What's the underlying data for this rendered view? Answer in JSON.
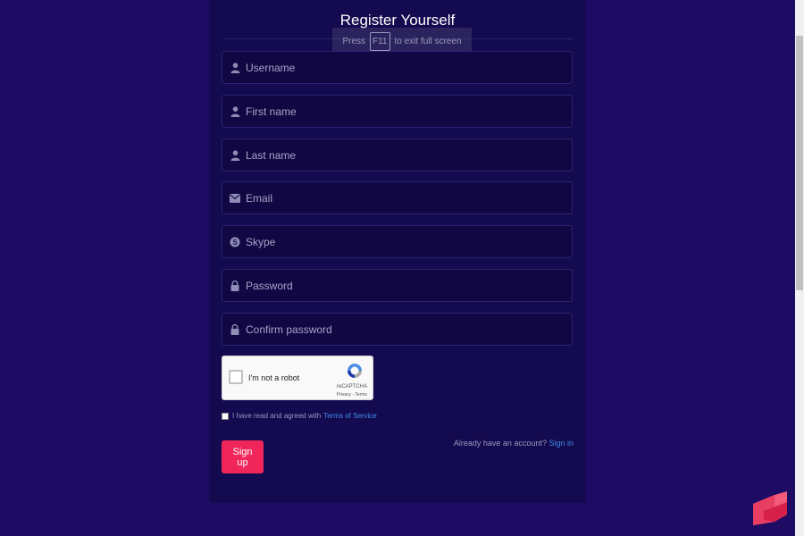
{
  "header": {
    "title": "Register Yourself"
  },
  "fullscreen_banner": {
    "prefix": "Press",
    "key": "F11",
    "suffix": "to exit full screen"
  },
  "form": {
    "username": {
      "placeholder": "Username",
      "icon": "user-icon"
    },
    "first_name": {
      "placeholder": "First name",
      "icon": "user-icon"
    },
    "last_name": {
      "placeholder": "Last name",
      "icon": "user-icon"
    },
    "email": {
      "placeholder": "Email",
      "icon": "envelope-icon"
    },
    "skype": {
      "placeholder": "Skype",
      "icon": "skype-icon"
    },
    "password": {
      "placeholder": "Password",
      "icon": "lock-icon"
    },
    "confirm_password": {
      "placeholder": "Confirm password",
      "icon": "lock-icon"
    }
  },
  "recaptcha": {
    "label": "I'm not a robot",
    "brand": "reCAPTCHA",
    "links": "Privacy - Terms"
  },
  "terms": {
    "text": "I have read and agreed with",
    "link": "Terms of Service"
  },
  "actions": {
    "signup_label": "Sign up",
    "account_text": "Already have an account?",
    "signin_link": "Sign in"
  },
  "colors": {
    "background": "#1e0b63",
    "panel": "#140a4f",
    "accent_button": "#f0265b",
    "link": "#3d8fe8"
  }
}
